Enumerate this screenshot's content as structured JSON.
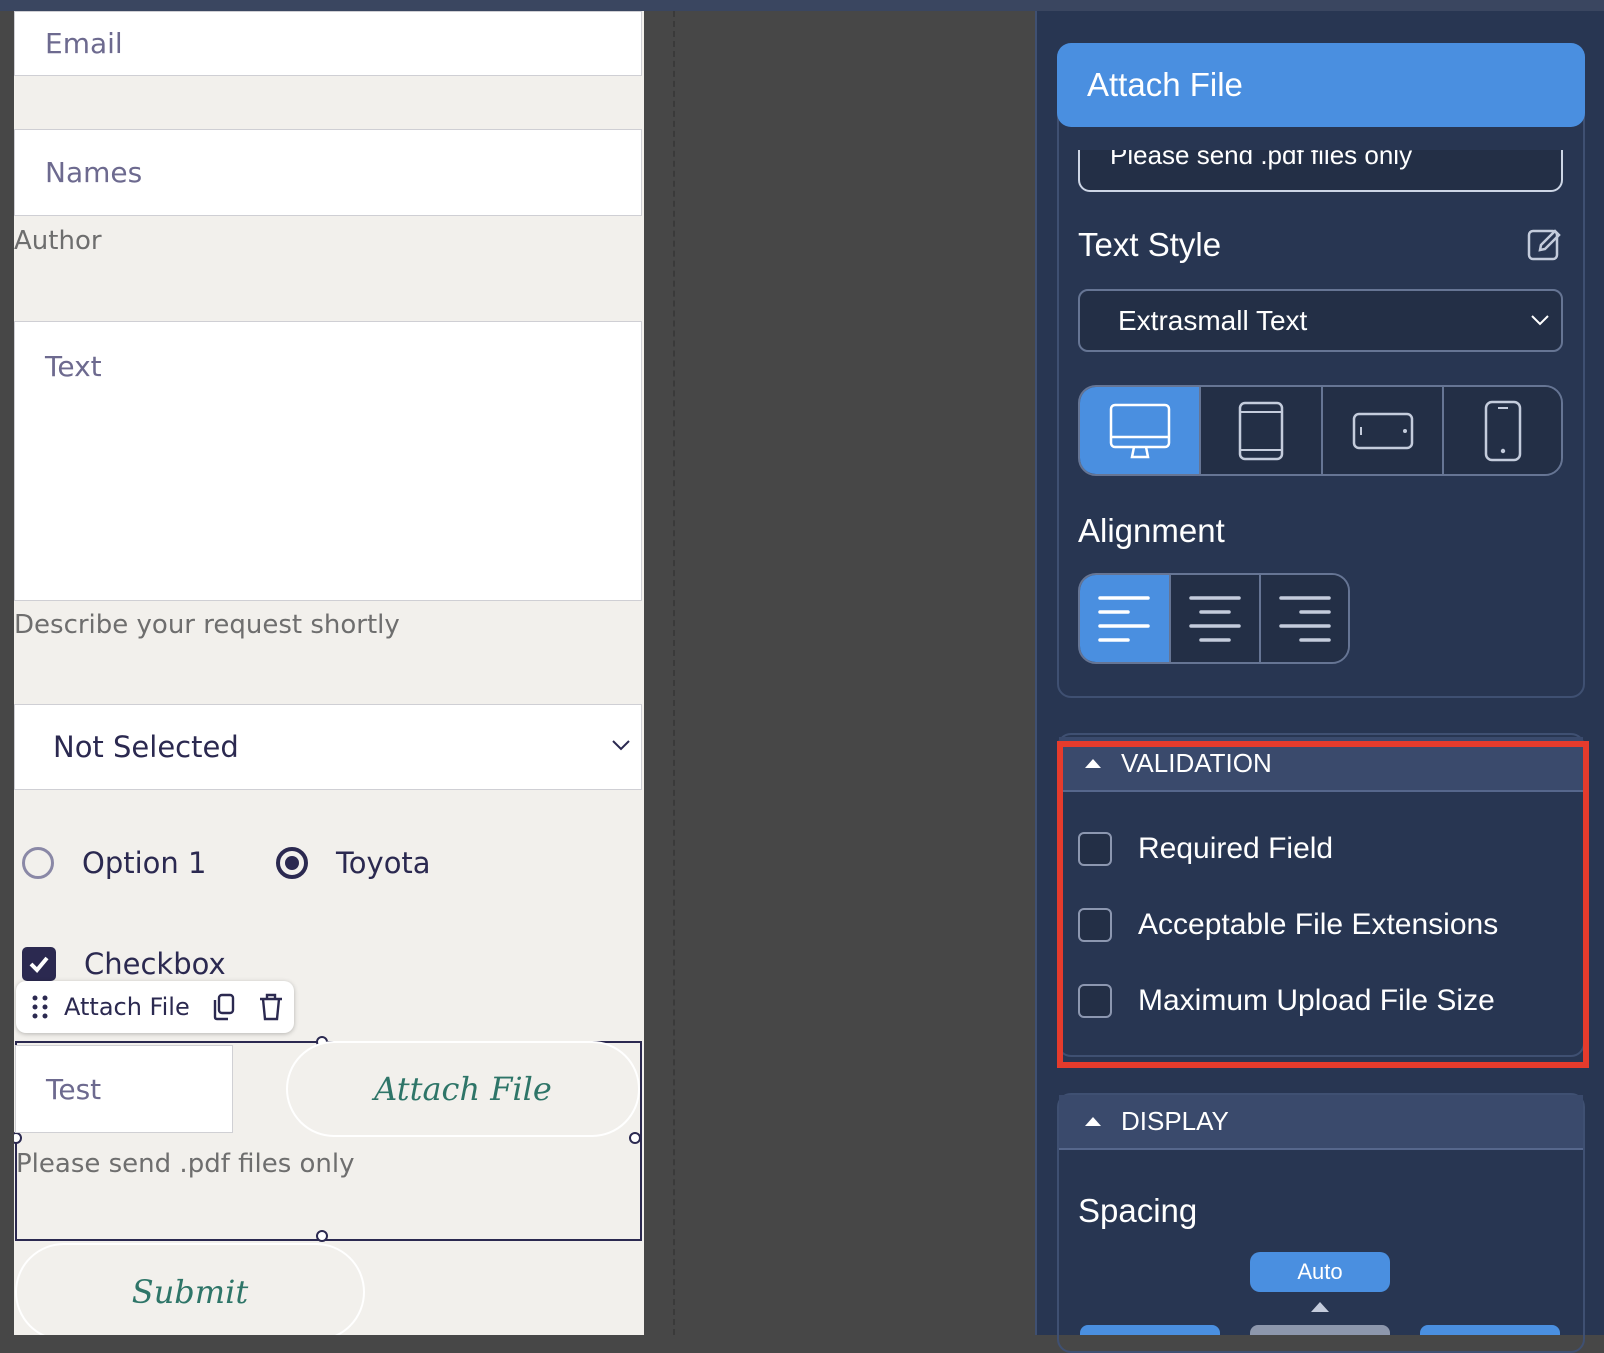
{
  "form": {
    "email_placeholder": "Email",
    "names_placeholder": "Names",
    "author_label": "Author",
    "text_placeholder": "Text",
    "text_helper": "Describe your request shortly",
    "select_value": "Not Selected",
    "radio_options": [
      "Option 1",
      "Toyota"
    ],
    "checkbox_label": "Checkbox",
    "toolbar_label": "Attach File",
    "test_input_value": "Test",
    "attach_button_label": "Attach File",
    "attach_helper": "Please send .pdf files only",
    "submit_label": "Submit"
  },
  "panel": {
    "title": "Attach File",
    "hint_text": "Please send .pdf files only",
    "text_style_label": "Text Style",
    "text_style_value": "Extrasmall Text",
    "alignment_label": "Alignment",
    "validation": {
      "header": "VALIDATION",
      "items": [
        "Required Field",
        "Acceptable File Extensions",
        "Maximum Upload File Size"
      ]
    },
    "display": {
      "header": "DISPLAY",
      "spacing_label": "Spacing",
      "spacing_value": "Auto"
    }
  },
  "colors": {
    "accent": "#4a8fe0",
    "panel_bg": "#283652",
    "highlight": "#e53b2c",
    "button_text": "#2e7568"
  }
}
